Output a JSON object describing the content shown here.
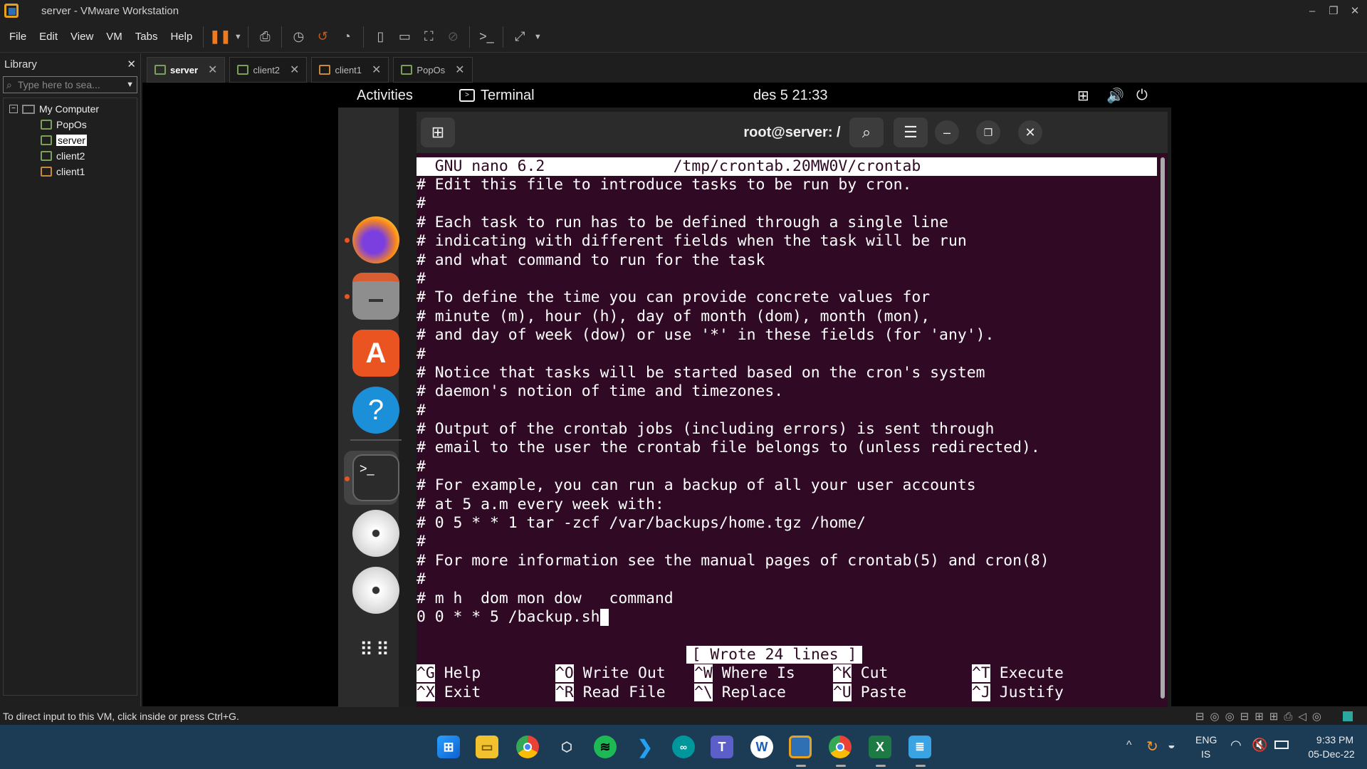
{
  "window": {
    "title": "server - VMware Workstation",
    "min": "–",
    "max": "❐",
    "close": "✕"
  },
  "menu": [
    "File",
    "Edit",
    "View",
    "VM",
    "Tabs",
    "Help"
  ],
  "library": {
    "title": "Library",
    "close": "✕",
    "search_placeholder": "Type here to sea...",
    "root": "My Computer",
    "items": [
      "PopOs",
      "server",
      "client2",
      "client1"
    ],
    "selected": "server"
  },
  "tabs": [
    {
      "label": "server",
      "active": true
    },
    {
      "label": "client2",
      "active": false
    },
    {
      "label": "client1",
      "active": false
    },
    {
      "label": "PopOs",
      "active": false
    }
  ],
  "gnome": {
    "activities": "Activities",
    "app": "Terminal",
    "clock": "des 5  21:33"
  },
  "terminal": {
    "title": "root@server: /"
  },
  "nano": {
    "header": "  GNU nano 6.2              /tmp/crontab.20MW0V/crontab",
    "lines": [
      "# Edit this file to introduce tasks to be run by cron.",
      "#",
      "# Each task to run has to be defined through a single line",
      "# indicating with different fields when the task will be run",
      "# and what command to run for the task",
      "#",
      "# To define the time you can provide concrete values for",
      "# minute (m), hour (h), day of month (dom), month (mon),",
      "# and day of week (dow) or use '*' in these fields (for 'any').",
      "#",
      "# Notice that tasks will be started based on the cron's system",
      "# daemon's notion of time and timezones.",
      "#",
      "# Output of the crontab jobs (including errors) is sent through",
      "# email to the user the crontab file belongs to (unless redirected).",
      "#",
      "# For example, you can run a backup of all your user accounts",
      "# at 5 a.m every week with:",
      "# 0 5 * * 1 tar -zcf /var/backups/home.tgz /home/",
      "#",
      "# For more information see the manual pages of crontab(5) and cron(8)",
      "#",
      "# m h  dom mon dow   command",
      "0 0 * * 5 /backup.sh"
    ],
    "status": "[ Wrote 24 lines ]",
    "shortcuts_row1": [
      {
        "key": "^G",
        "label": "Help"
      },
      {
        "key": "^O",
        "label": "Write Out"
      },
      {
        "key": "^W",
        "label": "Where Is"
      },
      {
        "key": "^K",
        "label": "Cut"
      },
      {
        "key": "^T",
        "label": "Execute"
      }
    ],
    "shortcuts_row2": [
      {
        "key": "^X",
        "label": "Exit"
      },
      {
        "key": "^R",
        "label": "Read File"
      },
      {
        "key": "^\\",
        "label": "Replace"
      },
      {
        "key": "^U",
        "label": "Paste"
      },
      {
        "key": "^J",
        "label": "Justify"
      }
    ]
  },
  "statusbar": {
    "text": "To direct input to this VM, click inside or press Ctrl+G."
  },
  "tray": {
    "lang": "ENG",
    "lang2": "IS",
    "time": "9:33 PM",
    "date": "05-Dec-22"
  },
  "icons": {
    "dock": [
      "firefox-icon",
      "files-icon",
      "app-center-icon",
      "help-icon",
      "terminal-icon",
      "disc-icon",
      "disc-icon",
      "app-grid-icon"
    ]
  }
}
